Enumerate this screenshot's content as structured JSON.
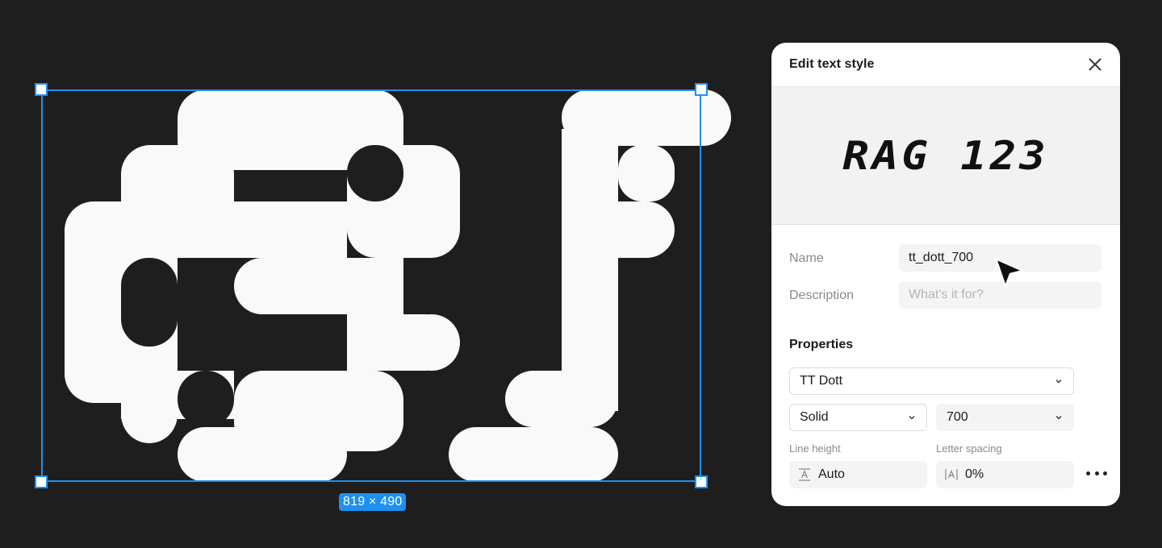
{
  "canvas": {
    "selection_size_label": "819 × 490"
  },
  "panel": {
    "title": "Edit text style",
    "preview_text": "RAG 123",
    "name_label": "Name",
    "name_value": "tt_dott_700",
    "description_label": "Description",
    "description_placeholder": "What's it for?",
    "properties_title": "Properties",
    "font_family": "TT Dott",
    "fill_type": "Solid",
    "font_weight": "700",
    "line_height_label": "Line height",
    "line_height_value": "Auto",
    "letter_spacing_label": "Letter spacing",
    "letter_spacing_value": "0%"
  },
  "icons": {
    "close": "close-icon",
    "chevron": "chevron-down-icon",
    "line_height": "line-height-icon",
    "letter_spacing": "letter-spacing-icon",
    "more": "more-icon",
    "cursor": "pointer-cursor-icon"
  },
  "colors": {
    "canvas_bg": "#1e1e1e",
    "glyph_fill": "#f9f9f9",
    "selection": "#1e90f0",
    "panel_bg": "#ffffff"
  }
}
